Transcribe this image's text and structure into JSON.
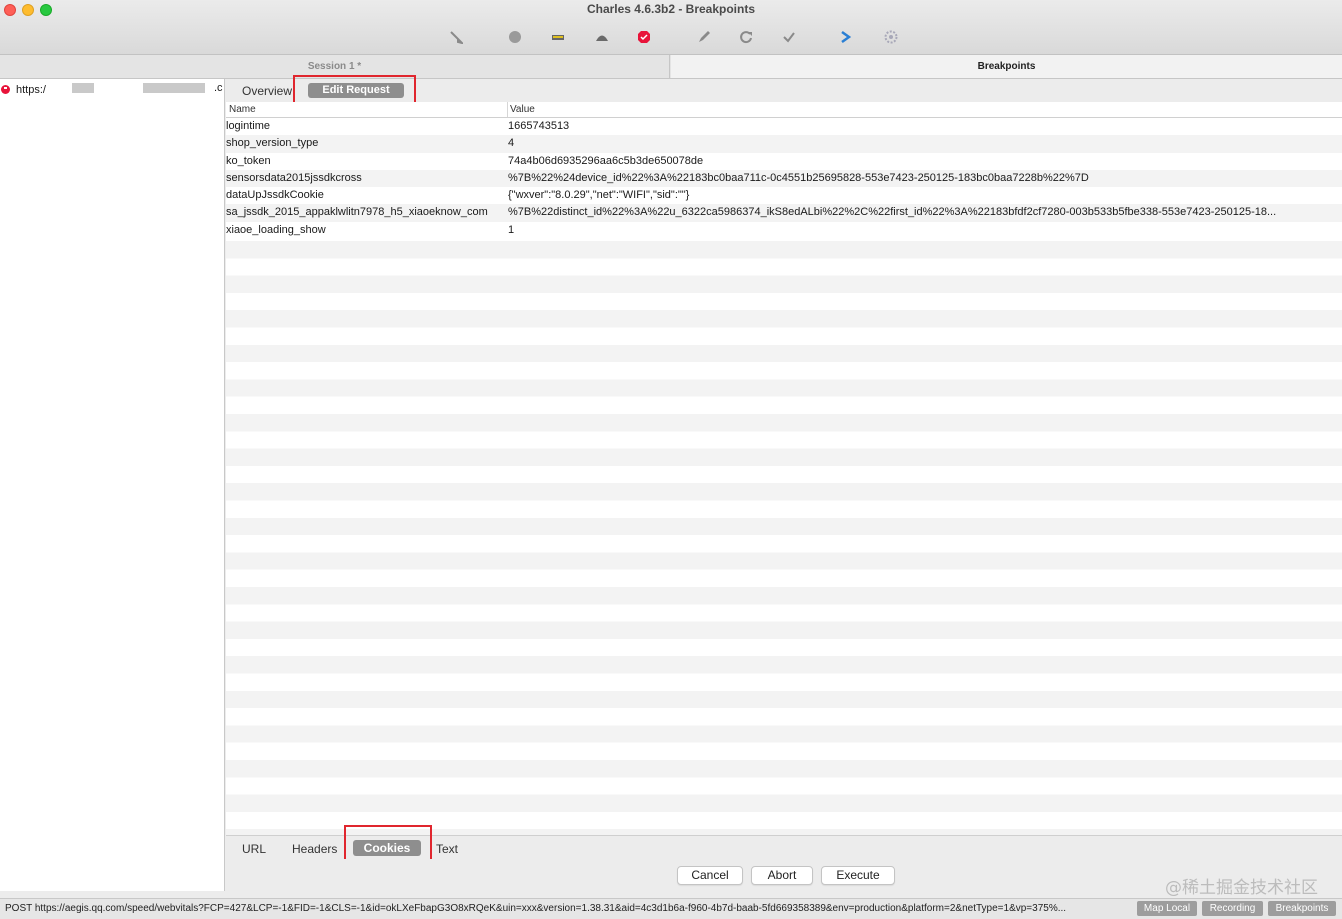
{
  "window": {
    "title": "Charles 4.6.3b2 - Breakpoints"
  },
  "toolbar": {
    "icons": [
      "broom-icon",
      "record-icon",
      "throttle-icon",
      "turtle-icon",
      "breakpoint-icon",
      "compose-pen-icon",
      "repeat-icon",
      "validate-check-icon",
      "tools-icon",
      "settings-gear-icon"
    ]
  },
  "tabs": {
    "session": "Session 1 *",
    "breakpoints": "Breakpoints"
  },
  "sidebar": {
    "entry_prefix": "https:/",
    "entry_suffix": ".c"
  },
  "request_tabs": {
    "overview": "Overview",
    "edit_request": "Edit Request"
  },
  "table": {
    "columns": [
      "Name",
      "Value"
    ],
    "rows": [
      {
        "name": "logintime",
        "value": "1665743513"
      },
      {
        "name": "shop_version_type",
        "value": "4"
      },
      {
        "name": "ko_token",
        "value": "74a4b06d6935296aa6c5b3de650078de"
      },
      {
        "name": "sensorsdata2015jssdkcross",
        "value": "%7B%22%24device_id%22%3A%22183bc0baa711c-0c4551b25695828-553e7423-250125-183bc0baa7228b%22%7D"
      },
      {
        "name": "dataUpJssdkCookie",
        "value": "{\"wxver\":\"8.0.29\",\"net\":\"WIFI\",\"sid\":\"\"}"
      },
      {
        "name": "sa_jssdk_2015_appaklwlitn7978_h5_xiaoeknow_com",
        "value": "%7B%22distinct_id%22%3A%22u_6322ca5986374_ikS8edALbi%22%2C%22first_id%22%3A%22183bfdf2cf7280-003b533b5fbe338-553e7423-250125-18..."
      },
      {
        "name": "xiaoe_loading_show",
        "value": "1"
      }
    ]
  },
  "bottom_tabs": {
    "url": "URL",
    "headers": "Headers",
    "cookies": "Cookies",
    "text": "Text"
  },
  "actions": {
    "cancel": "Cancel",
    "abort": "Abort",
    "execute": "Execute"
  },
  "status": {
    "url": "POST https://aegis.qq.com/speed/webvitals?FCP=427&LCP=-1&FID=-1&CLS=-1&id=okLXeFbapG3O8xRQeK&uin=xxx&version=1.38.31&aid=4c3d1b6a-f960-4b7d-baab-5fd669358389&env=production&platform=2&netType=1&vp=375%...",
    "map_local": "Map Local",
    "recording": "Recording",
    "breakpoints": "Breakpoints"
  },
  "watermark": "@稀土掘金技术社区"
}
